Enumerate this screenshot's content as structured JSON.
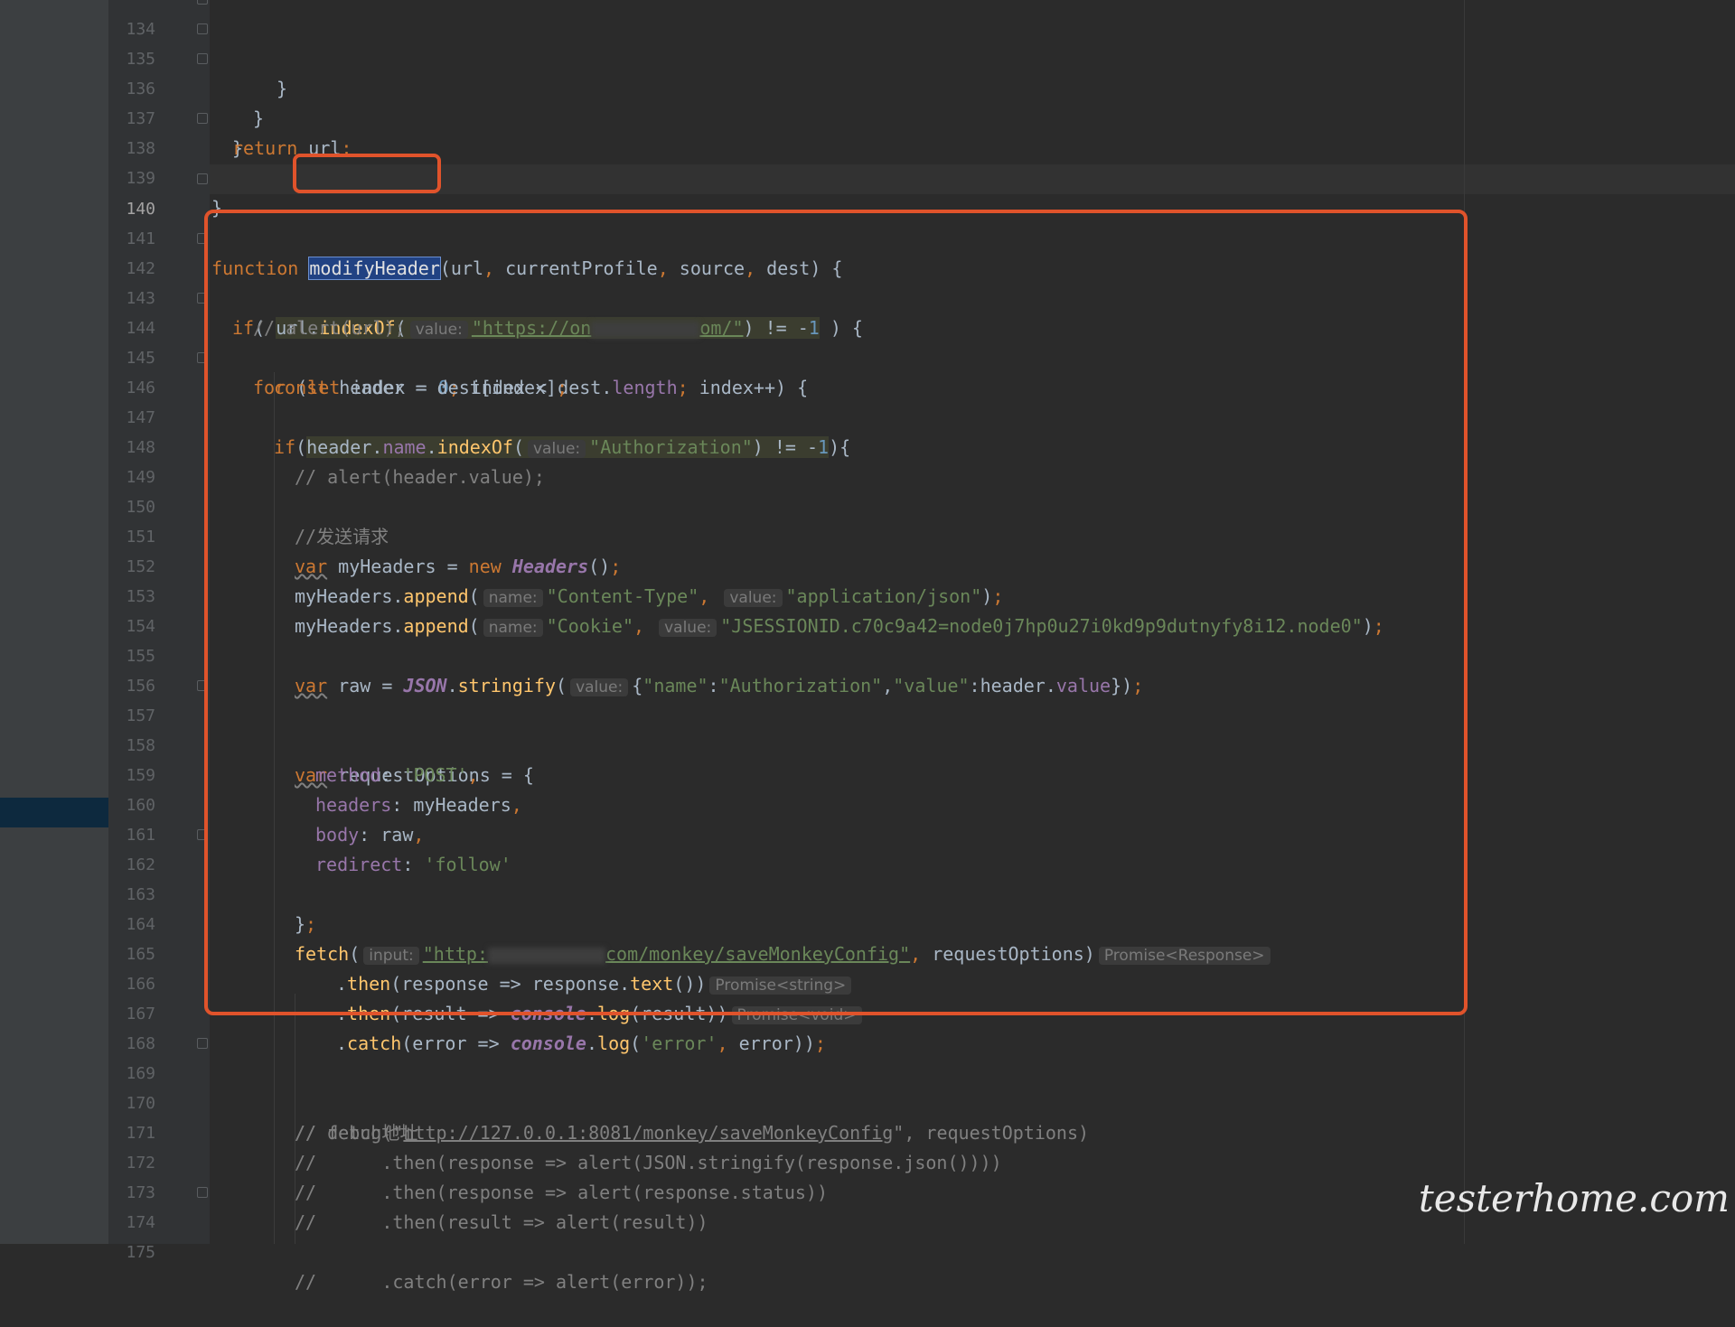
{
  "editor": {
    "line_numbers": [
      "134",
      "135",
      "136",
      "137",
      "138",
      "139",
      "140",
      "141",
      "142",
      "143",
      "144",
      "145",
      "146",
      "147",
      "148",
      "149",
      "150",
      "151",
      "152",
      "153",
      "154",
      "155",
      "156",
      "157",
      "158",
      "159",
      "160",
      "161",
      "162",
      "163",
      "164",
      "165",
      "166",
      "167",
      "168",
      "169",
      "170",
      "171",
      "172",
      "173",
      "174",
      "175"
    ],
    "hints": {
      "value": "value:",
      "name": "name:",
      "input": "input:",
      "promise_response": "Promise<Response>",
      "promise_string": "Promise<string>",
      "promise_void": "Promise<void>"
    },
    "strings": {
      "url_partial_start": "\"https://on",
      "url_partial_end": "om/\"",
      "authorization": "\"Authorization\"",
      "content_type": "\"Content-Type\"",
      "application_json": "\"application/json\"",
      "cookie": "\"Cookie\"",
      "jsessionid": "\"JSESSIONID.c70c9a42=node0j7hp0u27i0kd9p9dutnyfy8i12.node0\"",
      "post": "'POST'",
      "follow": "'follow'",
      "fetch_url_start": "\"http:",
      "fetch_url_end": "com/monkey/saveMonkeyConfig\"",
      "error_str": "'error'",
      "debug_url": "http://127.0.0.1:8081/monkey/saveMonkeyConfig"
    },
    "comments": {
      "c143": "// alert(url);",
      "c148": "// alert(header.value);",
      "c150": "//发送请求",
      "c169": "// debug地址",
      "c170_prefix": "// fetch(\"",
      "c170_suffix": "\", requestOptions)",
      "c171": "//      .then(response => alert(JSON.stringify(response.json())))",
      "c172": "//      .then(response => alert(response.status))",
      "c173": "//      .then(result => alert(result))",
      "c174": "//      .catch(error => alert(error));"
    },
    "function_name": "modifyHeader"
  },
  "watermark": "testerhome.com"
}
